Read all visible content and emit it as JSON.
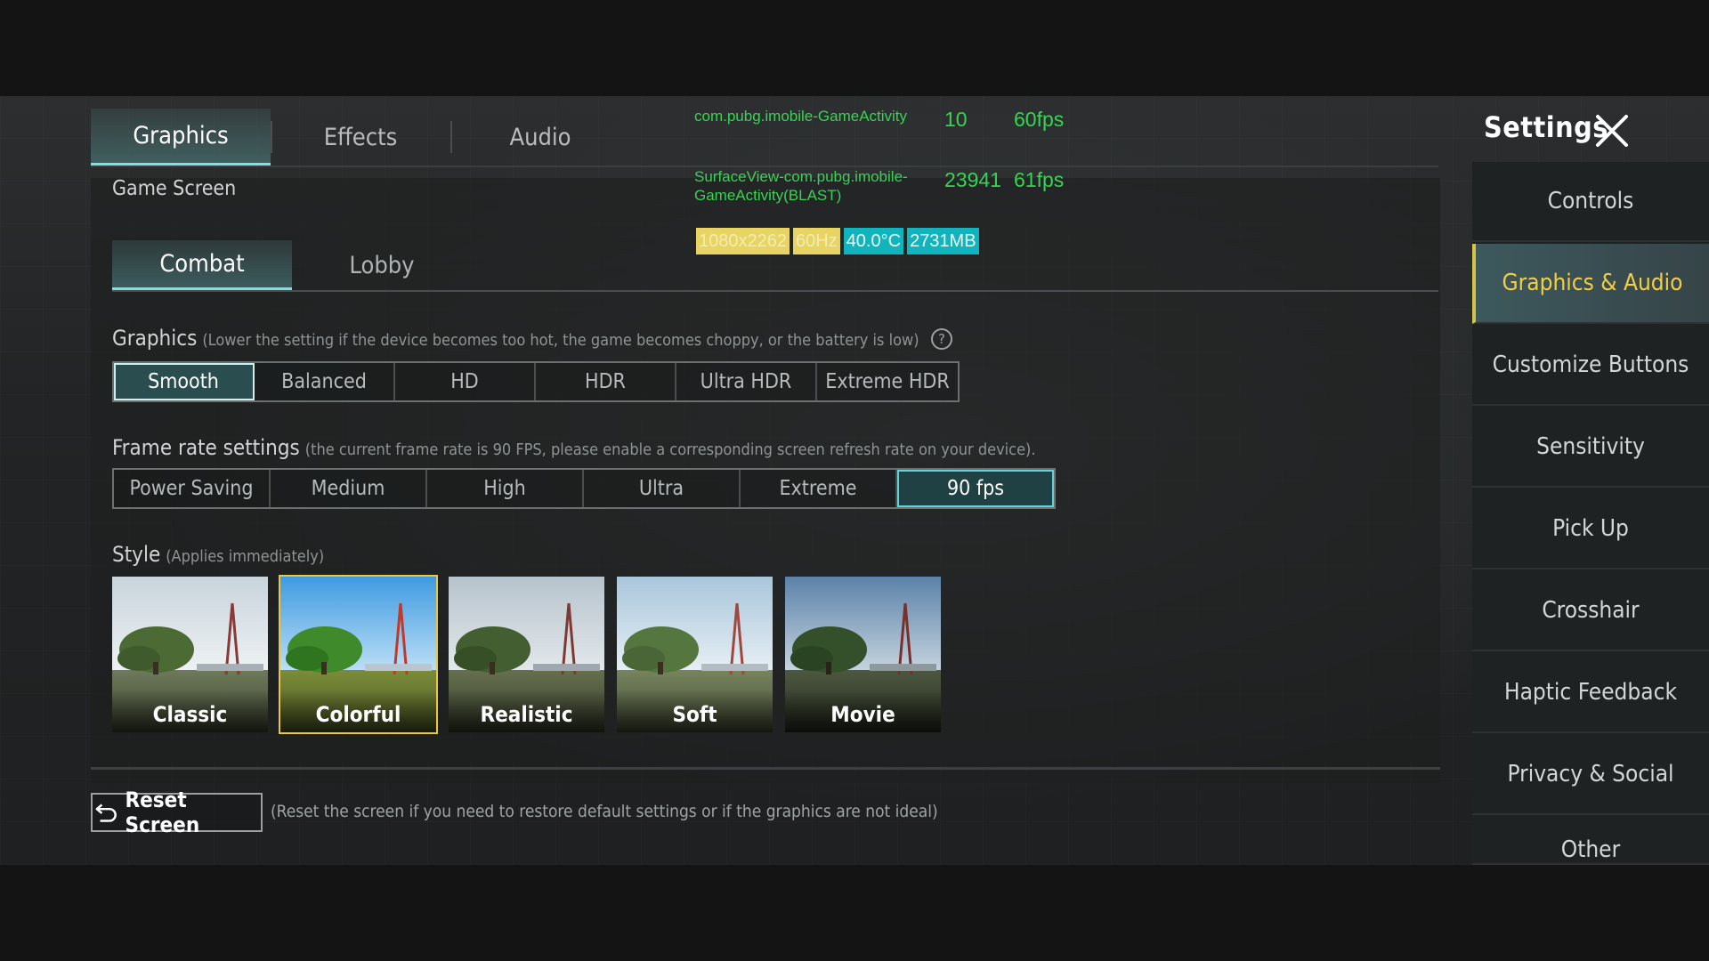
{
  "top_tabs": [
    {
      "label": "Graphics",
      "active": true
    },
    {
      "label": "Effects",
      "active": false
    },
    {
      "label": "Audio",
      "active": false
    }
  ],
  "debug": {
    "line1_label": "com.pubg.imobile-GameActivity",
    "line1_count": "10",
    "line1_fps": "60fps",
    "line2_label": "SurfaceView-com.pubg.imobile-GameActivity(BLAST)",
    "line2_count": "23941",
    "line2_fps": "61fps",
    "resolution": "1080x2262",
    "refresh": "60Hz",
    "temperature": "40.0°C",
    "memory": "2731MB"
  },
  "settings": {
    "title": "Settings",
    "sidebar": [
      {
        "label": "Controls",
        "active": false
      },
      {
        "label": "Graphics & Audio",
        "active": true
      },
      {
        "label": "Customize Buttons",
        "active": false
      },
      {
        "label": "Sensitivity",
        "active": false
      },
      {
        "label": "Pick Up",
        "active": false
      },
      {
        "label": "Crosshair",
        "active": false
      },
      {
        "label": "Haptic Feedback",
        "active": false
      },
      {
        "label": "Privacy & Social",
        "active": false
      },
      {
        "label": "Other",
        "active": false
      }
    ]
  },
  "main": {
    "game_screen_label": "Game Screen",
    "sub_tabs": [
      {
        "label": "Combat",
        "active": true
      },
      {
        "label": "Lobby",
        "active": false
      }
    ],
    "graphics": {
      "label": "Graphics",
      "hint": "(Lower the setting if the device becomes too hot, the game becomes choppy, or the battery is low)",
      "options": [
        "Smooth",
        "Balanced",
        "HD",
        "HDR",
        "Ultra HDR",
        "Extreme HDR"
      ],
      "selected": "Smooth"
    },
    "frame_rate": {
      "label": "Frame rate settings",
      "hint": "(the current frame rate is 90 FPS, please enable a corresponding screen refresh rate on your device).",
      "options": [
        "Power Saving",
        "Medium",
        "High",
        "Ultra",
        "Extreme",
        "90 fps"
      ],
      "selected": "90 fps"
    },
    "style": {
      "label": "Style",
      "hint": "(Applies immediately)",
      "options": [
        "Classic",
        "Colorful",
        "Realistic",
        "Soft",
        "Movie"
      ],
      "selected": "Colorful"
    },
    "reset": {
      "button_label": "Reset Screen",
      "hint": "(Reset the screen if you need to restore default settings or if the graphics are not ideal)"
    }
  }
}
